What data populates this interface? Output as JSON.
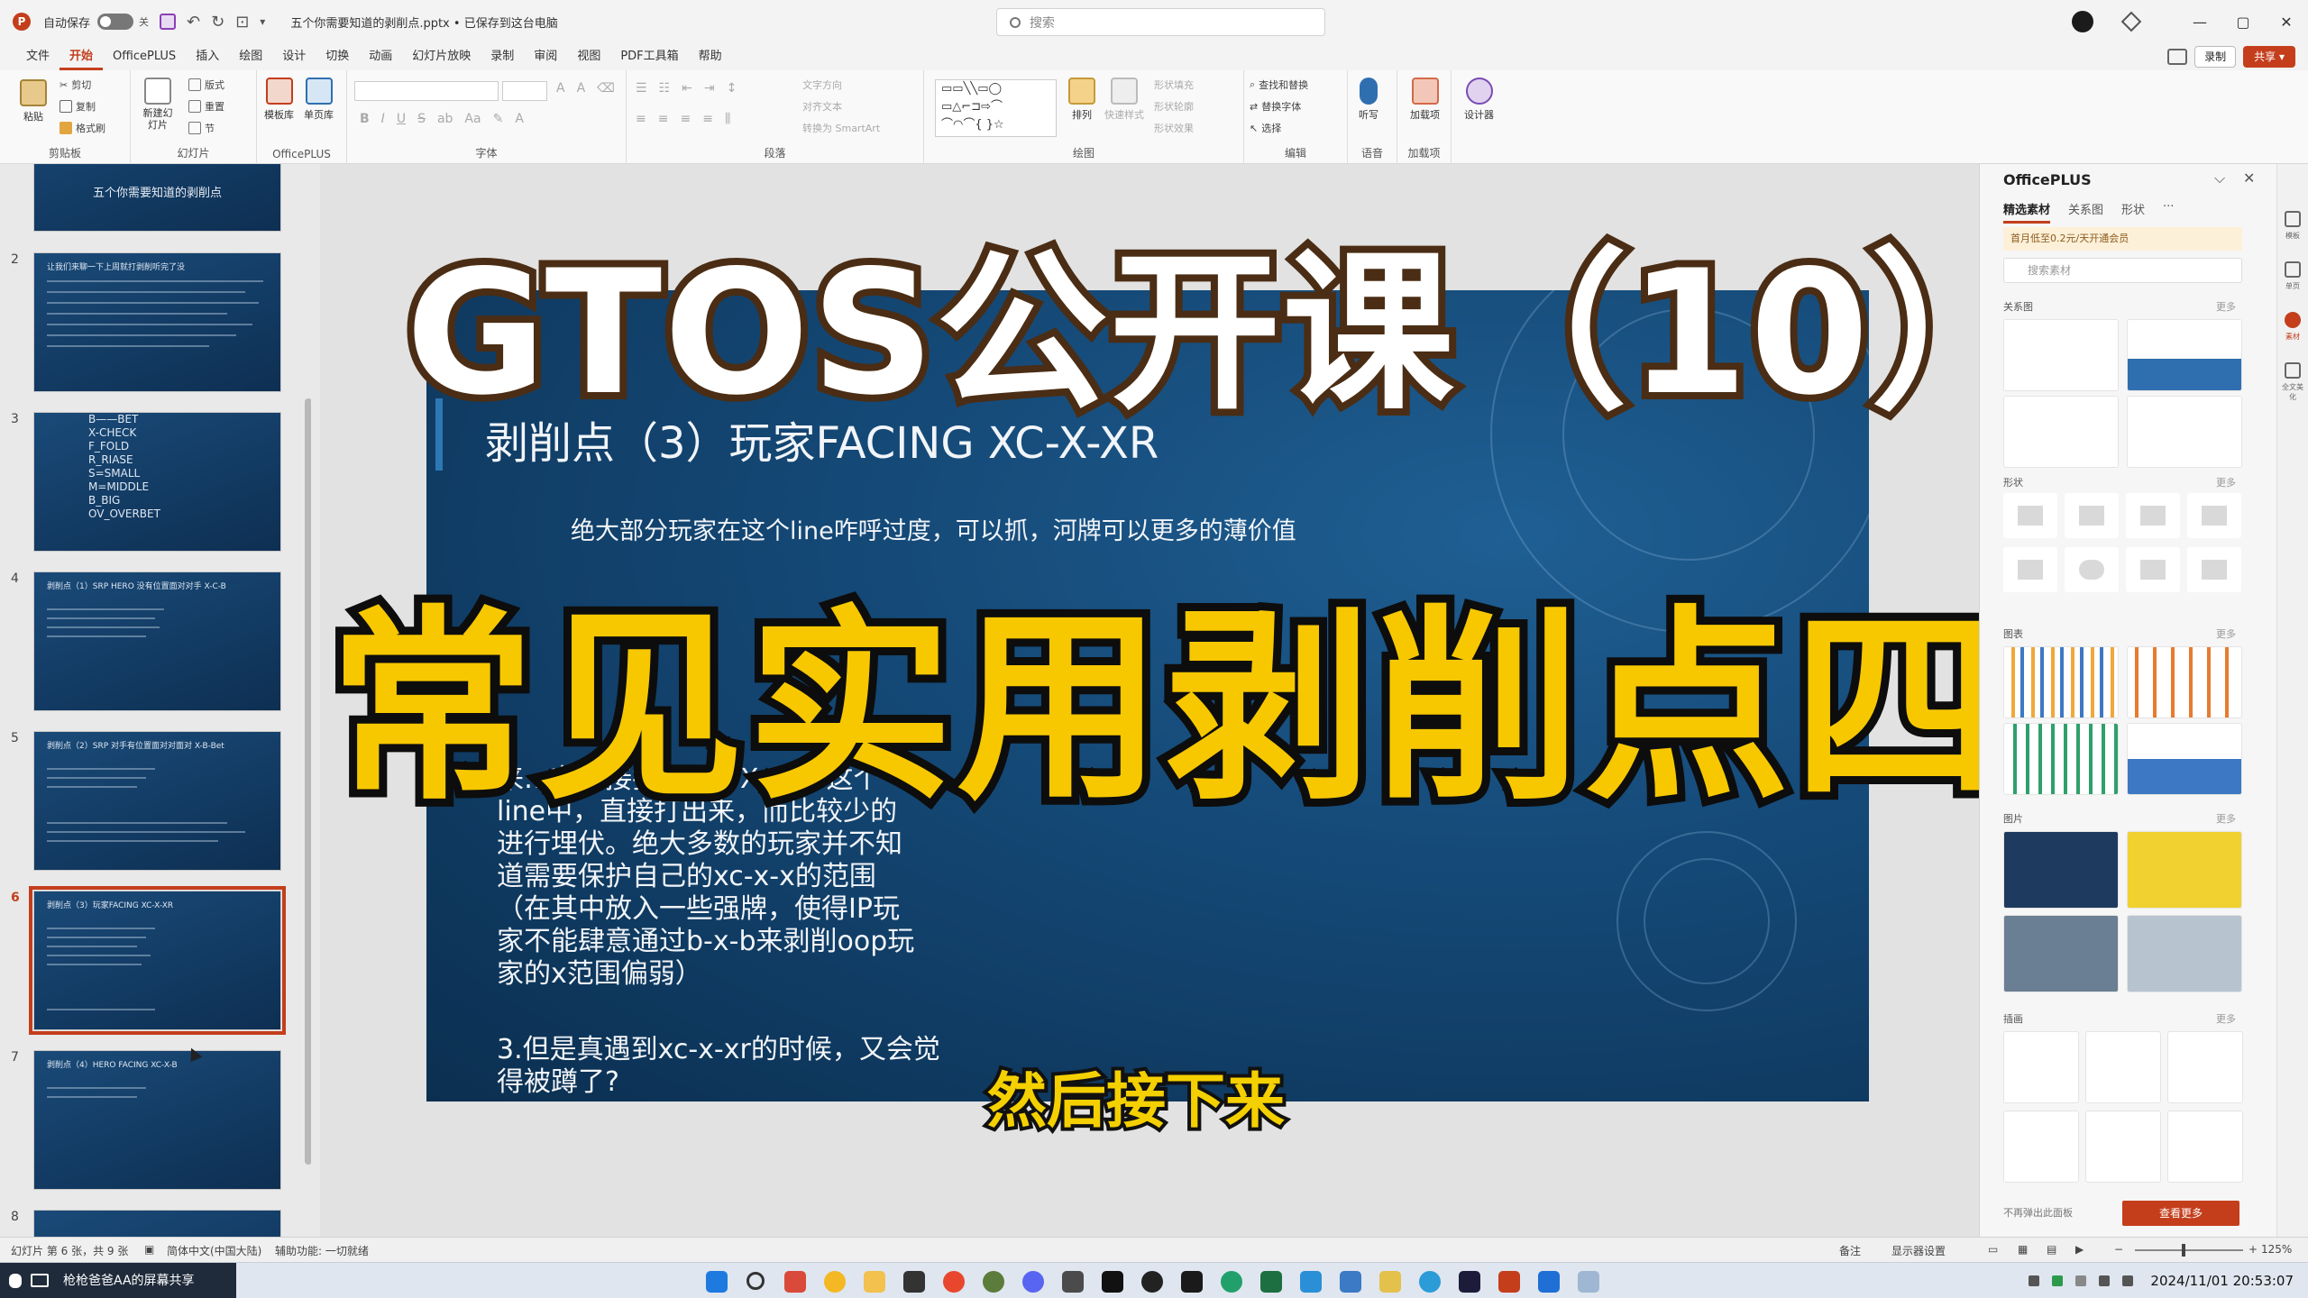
{
  "titlebar": {
    "autosave_label": "自动保存",
    "autosave_state": "关",
    "doc_title": "五个你需要知道的剥削点.pptx • 已保存到这台电脑",
    "search_placeholder": "搜索",
    "window_min": "—",
    "window_max": "▢",
    "window_close": "✕"
  },
  "menu": {
    "tabs": [
      "文件",
      "开始",
      "OfficePLUS",
      "插入",
      "绘图",
      "设计",
      "切换",
      "动画",
      "幻灯片放映",
      "录制",
      "审阅",
      "视图",
      "PDF工具箱",
      "帮助"
    ],
    "active": "开始",
    "record_label": "录制",
    "share_label": "共享"
  },
  "ribbon": {
    "clipboard": {
      "label": "剪贴板",
      "paste": "粘贴",
      "cut": "剪切",
      "copy": "复制",
      "format_painter": "格式刷"
    },
    "slides": {
      "label": "幻灯片",
      "new_slide": "新建幻灯片",
      "layout": "版式",
      "reset": "重置",
      "section": "节"
    },
    "officeplus": {
      "label": "OfficePLUS",
      "template": "模板库",
      "single_page": "单页库"
    },
    "font": {
      "label": "字体"
    },
    "paragraph": {
      "label": "段落",
      "text_direction": "文字方向",
      "align_text": "对齐文本",
      "smartart": "转换为 SmartArt"
    },
    "drawing": {
      "label": "绘图",
      "arrange": "排列",
      "quick_styles": "快速样式",
      "fill": "形状填充",
      "outline": "形状轮廓",
      "effects": "形状效果"
    },
    "editing": {
      "label": "编辑",
      "find_replace": "查找和替换",
      "replace_font": "替换字体",
      "select": "选择"
    },
    "voice": {
      "label": "语音",
      "dictate": "听写"
    },
    "addins": {
      "label": "加载项",
      "addins_btn": "加载项"
    },
    "designer": {
      "label": "",
      "designer_btn": "设计器"
    }
  },
  "thumbnails": {
    "numbers": [
      "2",
      "3",
      "4",
      "5",
      "6",
      "7",
      "8"
    ],
    "slide1_title": "五个你需要知道的剥削点",
    "slide2_title": "让我们来聊一下上周就打剥削听完了没",
    "slide3_lines": [
      "B——BET",
      "X-CHECK",
      "F_FOLD",
      "R_RIASE",
      "S=SMALL",
      "M=MIDDLE",
      "B_BIG",
      "OV_OVERBET"
    ],
    "slide4_title": "剥削点（1）SRP HERO 没有位置面对对手 X-C-B",
    "slide5_title": "剥削点（2）SRP 对手有位置面对对面对 X-B-Bet",
    "slide6_title": "剥削点（3）玩家FACING XC-X-XR",
    "slide7_title": "剥削点（4）HERO FACING XC-X-B",
    "active": "6"
  },
  "slide": {
    "heading": "剥削点（3）玩家FACING XC-X-XR",
    "line1": "绝大部分玩家在这个line咋呼过度，可以抓，河牌可以更多的薄价值",
    "para2": "来…有…接打出来。Xc-x-b这个line中，直接打出来，而比较少的进行埋伏。绝大多数的玩家并不知道需要保护自己的xc-x-x的范围（在其中放入一些强牌，使得IP玩家不能肆意通过b-x-b来剥削oop玩家的x范围偏弱）",
    "para3": "3.但是真遇到xc-x-xr的时候，又会觉得被蹲了?"
  },
  "overlay": {
    "title_top": "GTOS公开课（10）",
    "title_main": "常见实用剥削点四",
    "subtitle": "然后接下来"
  },
  "rightpane": {
    "title": "OfficePLUS",
    "tabs": [
      "精选素材",
      "关系图",
      "形状"
    ],
    "banner": "首月低至0.2元/天开通会员",
    "search_placeholder": "搜索素材",
    "sections": [
      "关系图",
      "形状",
      "图表",
      "图片",
      "插画"
    ],
    "more": "更多",
    "bottom_text": "不再弹出此面板",
    "view_more": "查看更多",
    "rail": [
      "模板",
      "单页",
      "素材",
      "全文美化"
    ]
  },
  "statusbar": {
    "slide_info": "幻灯片 第 6 张，共 9 张",
    "language": "简体中文(中国大陆)",
    "accessibility": "辅助功能: 一切就绪",
    "notes": "备注",
    "display": "显示器设置",
    "zoom": "125%"
  },
  "taskbar": {
    "notice": "枪枪爸爸AA的屏幕共享",
    "datetime": "2024/11/01 20:53:07"
  },
  "colors": {
    "accent": "#c43e1c",
    "slide_bg": "#154a78",
    "title_yellow": "#f7c800"
  }
}
